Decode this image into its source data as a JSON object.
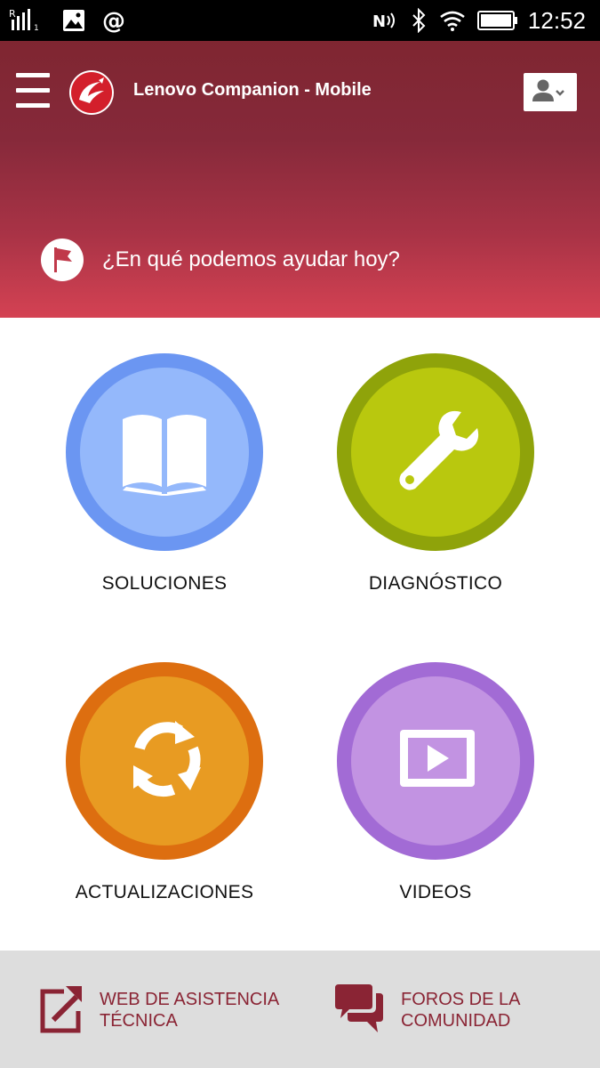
{
  "status_bar": {
    "time": "12:52",
    "icons": [
      "signal-icon",
      "image-icon",
      "at-icon",
      "nfc-icon",
      "bluetooth-icon",
      "wifi-icon",
      "battery-icon"
    ]
  },
  "header": {
    "title": "Lenovo Companion - Mobile",
    "help_prompt": "¿En qué podemos ayudar hoy?",
    "colors": {
      "top": "#7f2631",
      "bottom": "#d44253"
    }
  },
  "tiles": [
    {
      "label": "SOLUCIONES",
      "icon": "book-icon",
      "ring": "#6b96f2",
      "fill": "#94b8fb"
    },
    {
      "label": "DIAGNÓSTICO",
      "icon": "wrench-icon",
      "ring": "#8fa30a",
      "fill": "#b9c80e"
    },
    {
      "label": "ACTUALIZACIONES",
      "icon": "refresh-icon",
      "ring": "#dd6e10",
      "fill": "#e89b22"
    },
    {
      "label": "VIDEOS",
      "icon": "play-video-icon",
      "ring": "#a26bd5",
      "fill": "#c293e2"
    }
  ],
  "footer": {
    "links": [
      {
        "line1": "WEB DE ASISTENCIA",
        "line2": "TÉCNICA",
        "icon": "external-link-icon"
      },
      {
        "line1": "FOROS DE LA",
        "line2": "COMUNIDAD",
        "icon": "chat-bubbles-icon"
      }
    ],
    "accent": "#8a2434"
  }
}
